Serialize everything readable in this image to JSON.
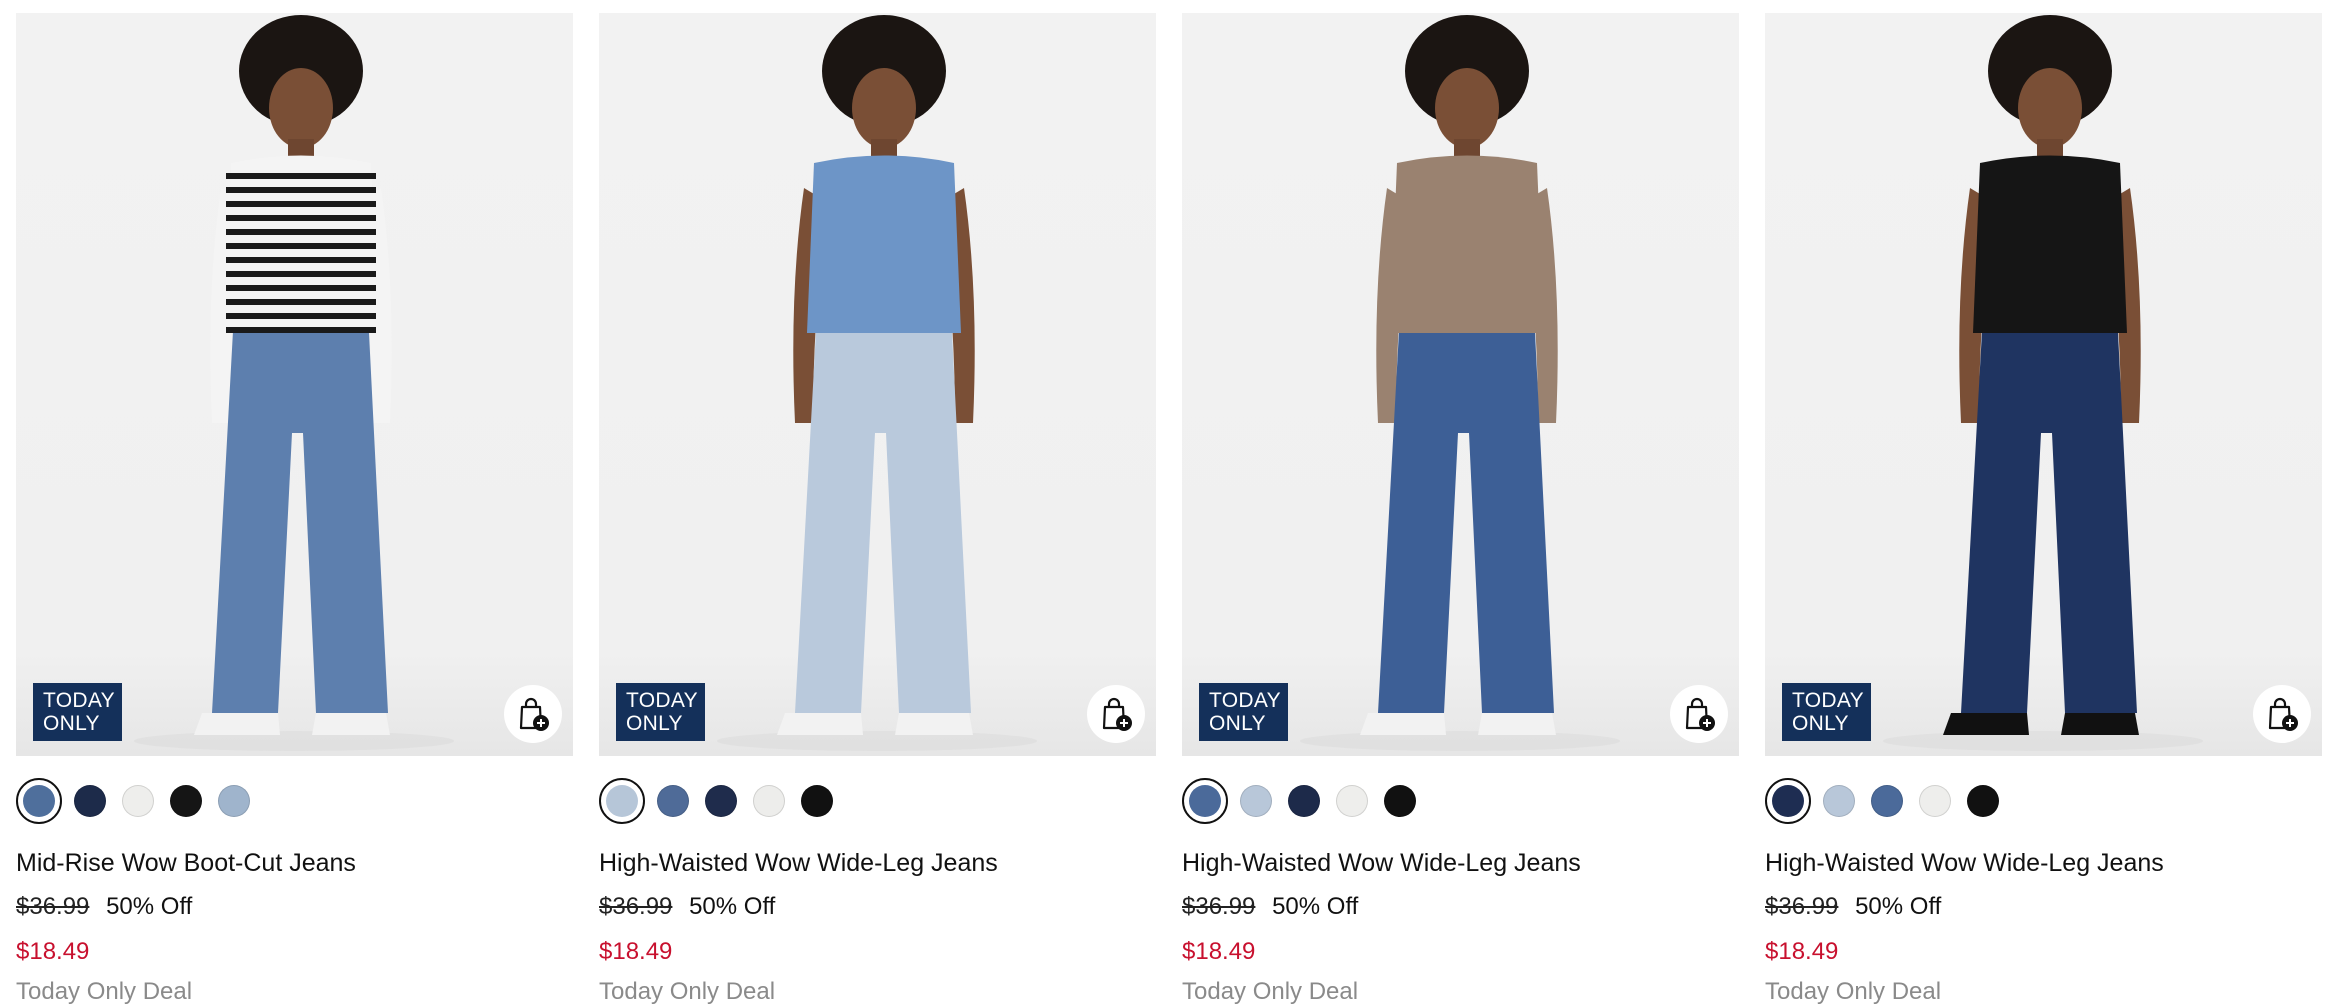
{
  "products": [
    {
      "name": "Mid-Rise Wow Boot-Cut Jeans",
      "badge_line1": "TODAY",
      "badge_line2": "ONLY",
      "original_price": "$36.99",
      "discount": "50% Off",
      "sale_price": "$18.49",
      "deal_text": "Today Only Deal",
      "top": "striped",
      "denim": "#5d7fae",
      "swatches": [
        "#4f6f9c",
        "#1d2b4a",
        "#eeeeec",
        "#151515",
        "#9fb4cc"
      ]
    },
    {
      "name": "High-Waisted Wow Wide-Leg Jeans",
      "badge_line1": "TODAY",
      "badge_line2": "ONLY",
      "original_price": "$36.99",
      "discount": "50% Off",
      "sale_price": "$18.49",
      "deal_text": "Today Only Deal",
      "top": "denim-vest",
      "denim": "#b9c9dc",
      "swatches": [
        "#b6c6d8",
        "#4f6b98",
        "#1f2c4c",
        "#ededeb",
        "#111111"
      ]
    },
    {
      "name": "High-Waisted Wow Wide-Leg Jeans",
      "badge_line1": "TODAY",
      "badge_line2": "ONLY",
      "original_price": "$36.99",
      "discount": "50% Off",
      "sale_price": "$18.49",
      "deal_text": "Today Only Deal",
      "top": "taupe-cardigan",
      "denim": "#3d5f96",
      "swatches": [
        "#4b6a9a",
        "#b8c7d9",
        "#1d2a4a",
        "#eeeeec",
        "#111111"
      ]
    },
    {
      "name": "High-Waisted Wow Wide-Leg Jeans",
      "badge_line1": "TODAY",
      "badge_line2": "ONLY",
      "original_price": "$36.99",
      "discount": "50% Off",
      "sale_price": "$18.49",
      "deal_text": "Today Only Deal",
      "top": "black-vest",
      "denim": "#1f3461",
      "swatches": [
        "#1e2d52",
        "#b8c7d9",
        "#4b6a9a",
        "#eeeeec",
        "#111111"
      ]
    }
  ],
  "icons": {
    "add_to_bag": "shopping-bag-plus-icon"
  },
  "colors": {
    "badge_bg": "#14305a",
    "sale_price": "#c8102e",
    "deal_text": "#8a8a8a"
  }
}
